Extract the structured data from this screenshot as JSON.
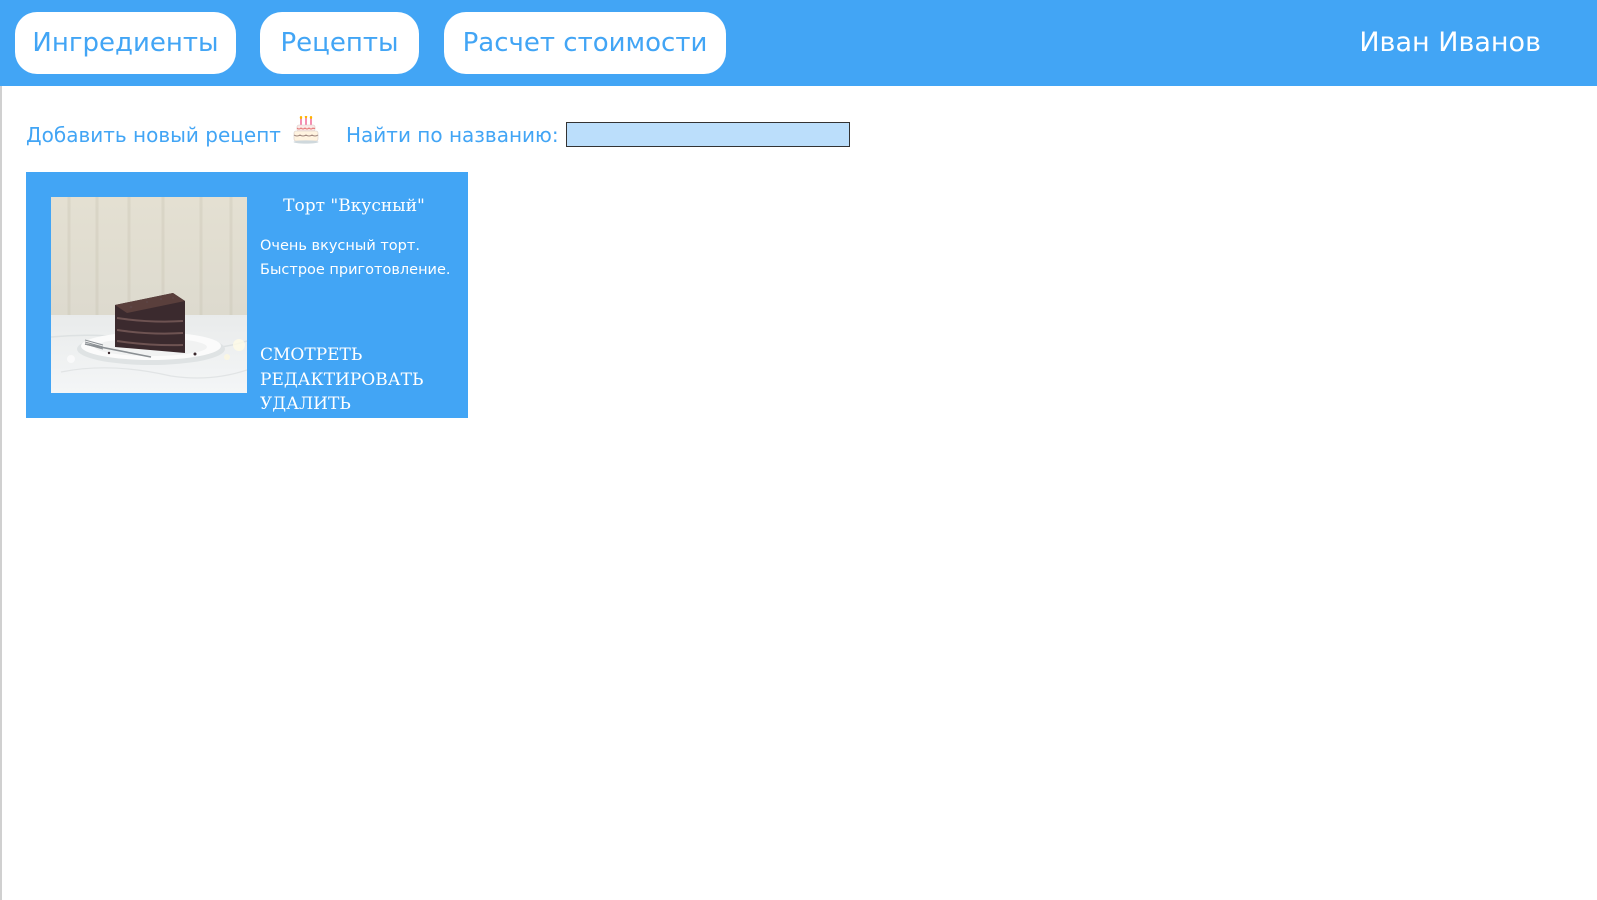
{
  "nav": {
    "ingredients_label": "Ингредиенты",
    "recipes_label": "Рецепты",
    "cost_label": "Расчет стоимости",
    "user_name": "Иван  Иванов"
  },
  "toolbar": {
    "add_recipe_label": "Добавить новый рецепт",
    "add_recipe_icon": "cake-icon",
    "search_label": "Найти по названию:",
    "search_value": ""
  },
  "recipes": [
    {
      "title": "Торт \"Вкусный\"",
      "description_lines": [
        "Очень вкусный торт.",
        "Быстрое приготовление."
      ],
      "actions": {
        "view": "СМОТРЕТЬ",
        "edit": "РЕДАКТИРОВАТЬ",
        "delete": "УДАЛИТЬ"
      },
      "image": "chocolate-cake-slice-photo"
    }
  ],
  "colors": {
    "accent": "#42a5f5",
    "search_bg": "#bbdefb",
    "white": "#ffffff"
  }
}
